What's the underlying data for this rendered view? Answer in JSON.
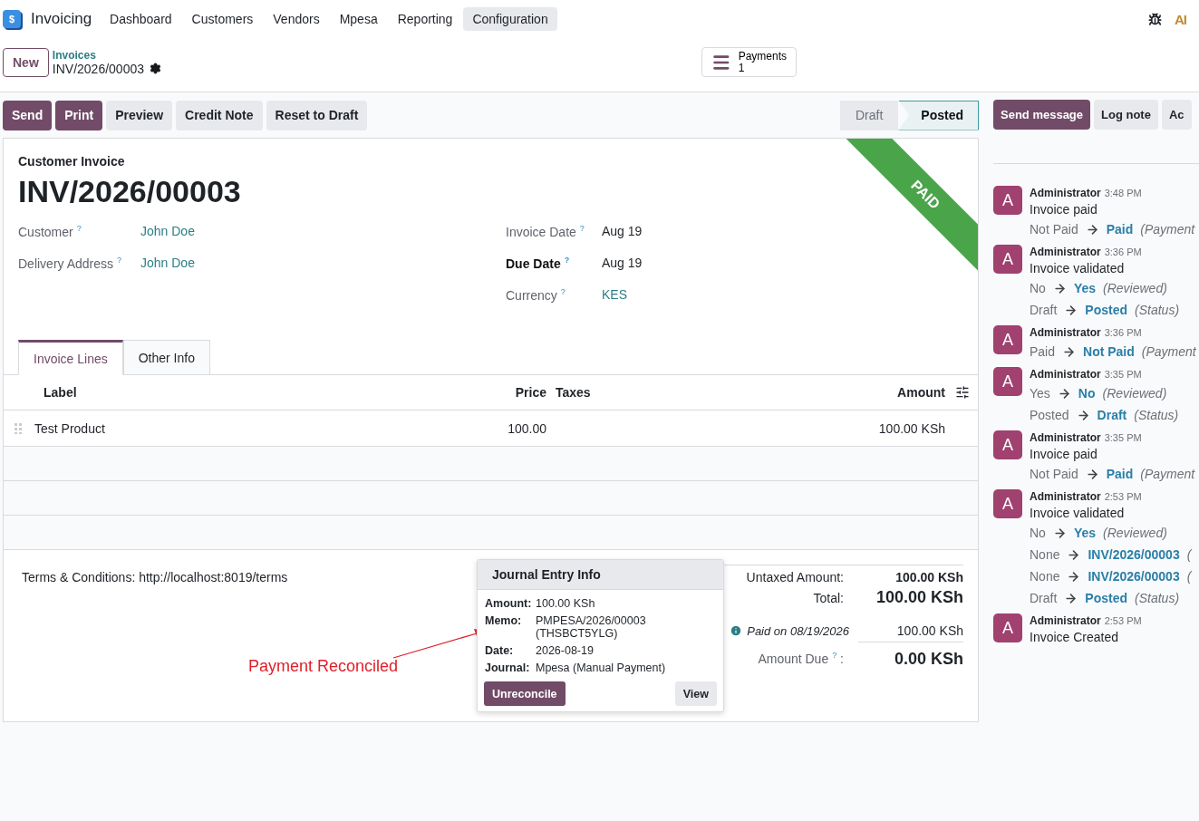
{
  "navbar": {
    "app_icon": "$",
    "app_name": "Invoicing",
    "menu": [
      {
        "label": "Dashboard",
        "selected": false
      },
      {
        "label": "Customers",
        "selected": false
      },
      {
        "label": "Vendors",
        "selected": false
      },
      {
        "label": "Mpesa",
        "selected": false
      },
      {
        "label": "Reporting",
        "selected": false
      },
      {
        "label": "Configuration",
        "selected": true
      }
    ],
    "ai_label": "AI"
  },
  "control_panel": {
    "new_button": "New",
    "breadcrumb": "Invoices",
    "record": "INV/2026/00003",
    "smart_button": {
      "label": "Payments",
      "count": "1"
    }
  },
  "actions": [
    {
      "label": "Send",
      "kind": "primary"
    },
    {
      "label": "Print",
      "kind": "primary"
    },
    {
      "label": "Preview",
      "kind": "secondary"
    },
    {
      "label": "Credit Note",
      "kind": "secondary"
    },
    {
      "label": "Reset to Draft",
      "kind": "secondary"
    }
  ],
  "status_bar": [
    {
      "label": "Draft",
      "selected": false
    },
    {
      "label": "Posted",
      "selected": true
    }
  ],
  "form": {
    "type_label": "Customer Invoice",
    "name": "INV/2026/00003",
    "ribbon": "PAID",
    "left_fields": [
      {
        "label": "Customer",
        "help": "?",
        "value": "John Doe",
        "link": true,
        "bold": false
      },
      {
        "label": "Delivery Address",
        "help": "?",
        "value": "John Doe",
        "link": true,
        "bold": false
      }
    ],
    "right_fields": [
      {
        "label": "Invoice Date",
        "help": "?",
        "value": "Aug 19",
        "link": false,
        "bold": false
      },
      {
        "label": "Due Date",
        "help": "?",
        "value": "Aug 19",
        "link": false,
        "bold": true
      },
      {
        "label": "Currency",
        "help": "?",
        "value": "KES",
        "link": true,
        "bold": false
      }
    ]
  },
  "tabs": [
    {
      "label": "Invoice Lines",
      "selected": true
    },
    {
      "label": "Other Info",
      "selected": false
    }
  ],
  "table": {
    "columns": [
      "Label",
      "Price",
      "Taxes",
      "Amount"
    ],
    "rows": [
      {
        "label": "Test Product",
        "price": "100.00",
        "amount": "100.00 KSh"
      }
    ]
  },
  "terms": "Terms & Conditions: http://localhost:8019/terms",
  "totals": {
    "untaxed_label": "Untaxed Amount:",
    "untaxed": "100.00 KSh",
    "total_label": "Total:",
    "total": "100.00 KSh",
    "payment_label": "Paid on 08/19/2026",
    "payment_amount": "100.00 KSh",
    "due_label": "Amount Due",
    "due_help": "?",
    "due_colon": ":",
    "due": "0.00 KSh"
  },
  "popover": {
    "title": "Journal Entry Info",
    "rows": [
      {
        "label": "Amount:",
        "value": "100.00 KSh"
      },
      {
        "label": "Memo:",
        "value": "PMPESA/2026/00003 (THSBCT5YLG)"
      },
      {
        "label": "Date:",
        "value": "2026-08-19"
      },
      {
        "label": "Journal:",
        "value": "Mpesa (Manual Payment)"
      }
    ],
    "buttons": [
      {
        "label": "Unreconcile",
        "kind": "primary"
      },
      {
        "label": "View",
        "kind": "secondary"
      }
    ]
  },
  "annotation": "Payment Reconciled",
  "chatter_buttons": [
    {
      "label": "Send message",
      "kind": "primary"
    },
    {
      "label": "Log note",
      "kind": "secondary"
    },
    {
      "label": "Ac",
      "kind": "secondary"
    }
  ],
  "chatter": [
    {
      "avatar": "A",
      "author": "Administrator",
      "time": "3:48 PM",
      "body": "Invoice paid",
      "changes": [
        {
          "old": "Not Paid",
          "new": "Paid",
          "field": "(Payment"
        }
      ]
    },
    {
      "avatar": "A",
      "author": "Administrator",
      "time": "3:36 PM",
      "body": "Invoice validated",
      "changes": [
        {
          "old": "No",
          "new": "Yes",
          "field": "(Reviewed)"
        },
        {
          "old": "Draft",
          "new": "Posted",
          "field": "(Status)"
        }
      ]
    },
    {
      "avatar": "A",
      "author": "Administrator",
      "time": "3:36 PM",
      "changes": [
        {
          "old": "Paid",
          "new": "Not Paid",
          "field": "(Payment"
        }
      ]
    },
    {
      "avatar": "A",
      "author": "Administrator",
      "time": "3:35 PM",
      "changes": [
        {
          "old": "Yes",
          "new": "No",
          "field": "(Reviewed)"
        },
        {
          "old": "Posted",
          "new": "Draft",
          "field": "(Status)"
        }
      ]
    },
    {
      "avatar": "A",
      "author": "Administrator",
      "time": "3:35 PM",
      "body": "Invoice paid",
      "changes": [
        {
          "old": "Not Paid",
          "new": "Paid",
          "field": "(Payment"
        }
      ]
    },
    {
      "avatar": "A",
      "author": "Administrator",
      "time": "2:53 PM",
      "body": "Invoice validated",
      "changes": [
        {
          "old": "No",
          "new": "Yes",
          "field": "(Reviewed)"
        },
        {
          "old": "None",
          "new": "INV/2026/00003",
          "field": "("
        },
        {
          "old": "None",
          "new": "INV/2026/00003",
          "field": "("
        },
        {
          "old": "Draft",
          "new": "Posted",
          "field": "(Status)"
        }
      ]
    },
    {
      "avatar": "A",
      "author": "Administrator",
      "time": "2:53 PM",
      "body": "Invoice Created"
    }
  ]
}
